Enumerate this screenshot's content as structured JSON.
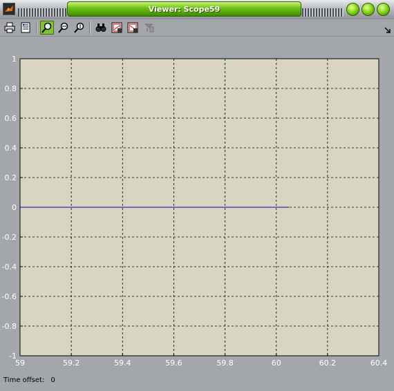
{
  "window": {
    "title": "Viewer: Scope59"
  },
  "toolbar": {
    "buttons": [
      {
        "name": "print-icon"
      },
      {
        "name": "parameters-icon"
      },
      {
        "name": "zoom-icon",
        "active": true
      },
      {
        "name": "zoom-x-icon"
      },
      {
        "name": "zoom-y-icon"
      },
      {
        "name": "autoscale-icon"
      },
      {
        "name": "save-axes-icon"
      },
      {
        "name": "restore-axes-icon"
      },
      {
        "name": "floating-scope-icon",
        "disabled": true
      }
    ]
  },
  "status": {
    "label": "Time offset:",
    "value": "0"
  },
  "colors": {
    "plot_bg": "#d8d6c0",
    "line": "#0000cc",
    "tick_text": "#ffffff"
  },
  "chart_data": {
    "type": "line",
    "title": "",
    "xlabel": "",
    "ylabel": "",
    "xlim": [
      59,
      60.4
    ],
    "ylim": [
      -1,
      1
    ],
    "grid": true,
    "x_ticks": [
      "59",
      "59.2",
      "59.4",
      "59.6",
      "59.8",
      "60",
      "60.2",
      "60.4"
    ],
    "y_ticks": [
      "1",
      "0.8",
      "0.6",
      "0.4",
      "0.2",
      "0",
      "-0.2",
      "-0.4",
      "-0.6",
      "-0.8",
      "-1"
    ],
    "series": [
      {
        "x": [
          59,
          60.05
        ],
        "y": [
          0,
          0
        ]
      }
    ]
  }
}
